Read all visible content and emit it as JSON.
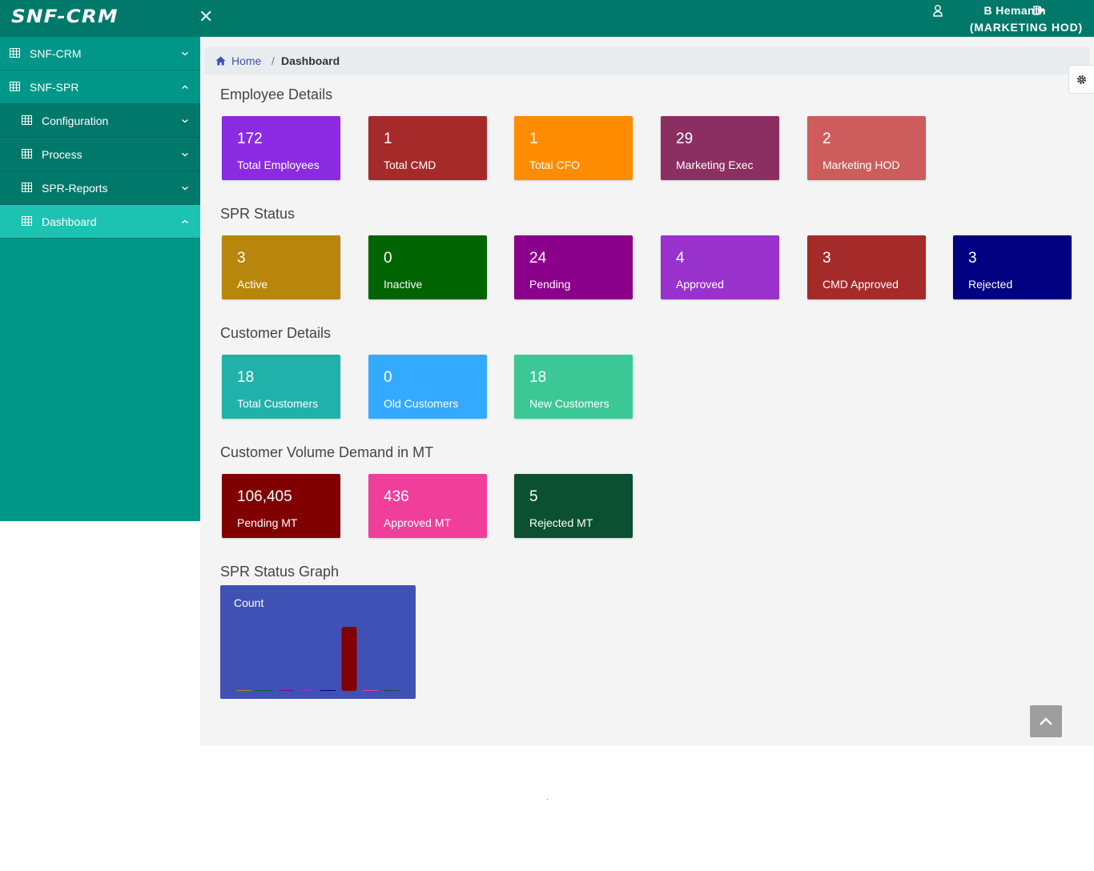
{
  "header": {
    "logo": "SNF-CRM",
    "user_name": "B Hemanth",
    "user_role": "(MARKETING HOD)",
    "icons": [
      "close-icon",
      "user-icon",
      "logout-icon"
    ]
  },
  "sidebar": {
    "items": [
      {
        "label": "SNF-CRM",
        "chevron": "down",
        "icon": "table-icon"
      },
      {
        "label": "SNF-SPR",
        "chevron": "up",
        "icon": "table-icon"
      },
      {
        "label": "Configuration",
        "chevron": "down",
        "icon": "table-icon"
      },
      {
        "label": "Process",
        "chevron": "down",
        "icon": "table-icon"
      },
      {
        "label": "SPR-Reports",
        "chevron": "down",
        "icon": "table-icon"
      },
      {
        "label": "Dashboard",
        "chevron": "up",
        "icon": "table-icon",
        "active": true
      }
    ]
  },
  "breadcrumb": {
    "home": "Home",
    "separator": "/",
    "current": "Dashboard"
  },
  "sections": {
    "employee": {
      "title": "Employee Details",
      "cards": [
        {
          "value": "172",
          "label": "Total Employees",
          "color": "#8a2be2"
        },
        {
          "value": "1",
          "label": "Total CMD",
          "color": "#a52a2a"
        },
        {
          "value": "1",
          "label": "Total CFO",
          "color": "#ff8c00"
        },
        {
          "value": "29",
          "label": "Marketing Exec",
          "color": "#8b2f62"
        },
        {
          "value": "2",
          "label": "Marketing HOD",
          "color": "#cd5c5c"
        }
      ]
    },
    "spr": {
      "title": "SPR Status",
      "cards": [
        {
          "value": "3",
          "label": "Active",
          "color": "#b8860b"
        },
        {
          "value": "0",
          "label": "Inactive",
          "color": "#006400"
        },
        {
          "value": "24",
          "label": "Pending",
          "color": "#8b008b"
        },
        {
          "value": "4",
          "label": "Approved",
          "color": "#9932cc"
        },
        {
          "value": "3",
          "label": "CMD Approved",
          "color": "#a52a2a"
        },
        {
          "value": "3",
          "label": "Rejected",
          "color": "#000080"
        }
      ]
    },
    "customer": {
      "title": "Customer Details",
      "cards": [
        {
          "value": "18",
          "label": "Total Customers",
          "color": "#20b2aa"
        },
        {
          "value": "0",
          "label": "Old Customers",
          "color": "#33aaff"
        },
        {
          "value": "18",
          "label": "New Customers",
          "color": "#3cc896"
        }
      ]
    },
    "volume": {
      "title": "Customer Volume Demand in MT",
      "cards": [
        {
          "value": "106,405",
          "label": "Pending MT",
          "color": "#800000"
        },
        {
          "value": "436",
          "label": "Approved MT",
          "color": "#ef3f9b"
        },
        {
          "value": "5",
          "label": "Rejected MT",
          "color": "#0b5131"
        }
      ]
    },
    "graph": {
      "title": "SPR Status Graph"
    }
  },
  "chart_data": {
    "type": "bar",
    "ylabel": "Count",
    "grid": false,
    "legend": "none",
    "values": [
      3,
      0,
      4,
      4,
      3,
      106405,
      436,
      5
    ],
    "colors": [
      "#b8860b",
      "#006400",
      "#8b008b",
      "#9932cc",
      "#000080",
      "#800000",
      "#ef3f9b",
      "#0b5131"
    ]
  },
  "colors": {
    "primary": "#009688",
    "header": "#00796b",
    "accent": "#3f51b5",
    "active": "#1dc3b2"
  }
}
